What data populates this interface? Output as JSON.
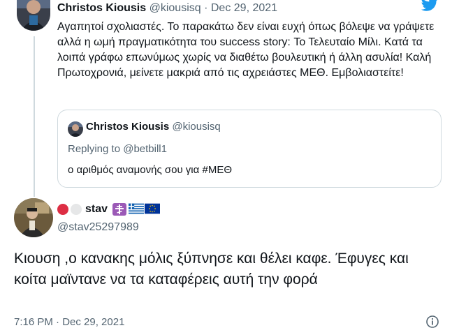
{
  "parent_tweet": {
    "author_name": "Christos Kiousis",
    "author_handle": "@kiousisq",
    "separator": "·",
    "date": "Dec 29, 2021",
    "text": "Αγαπητοί σχολιαστές. Το παρακάτω δεν είναι ευχή όπως βόλεψε να γράψετε αλλά η ωμή πραγματικότητα του success story: Το Τελευταίο Μίλι. Κατά τα λοιπά γράφω επωνύμως χωρίς να διαθέτω βουλευτική ή άλλη ασυλία! Καλή Πρωτοχρονιά, μείνετε μακριά από τις αχρειάστες ΜΕΘ. Εμβολιαστείτε!",
    "platform_icon": "twitter-bird-icon",
    "quoted_tweet": {
      "author_name": "Christos Kiousis",
      "author_handle": "@kiousisq",
      "replying_label": "Replying to",
      "replying_handle": "@betbill1",
      "text": "ο αριθμός αναμονής σου για #ΜΕΘ"
    }
  },
  "main_tweet": {
    "display_name": "stav",
    "name_emojis": [
      "red-circle-icon",
      "white-circle-icon",
      "orthodox-cross-icon",
      "greece-flag-icon",
      "eu-flag-icon"
    ],
    "handle": "@stav25297989",
    "text": "Κιουση ,ο κανακης μόλις ξύπνησε και θέλει καφε. Έφυγες και κοίτα μαϊντανε να τα καταφέρεις αυτή την φορά",
    "timestamp": "7:16 PM · Dec 29, 2021"
  },
  "colors": {
    "twitter_blue": "#1d9bf0",
    "text_primary": "#0f1419",
    "text_secondary": "#536471",
    "border": "#cfd9de"
  }
}
